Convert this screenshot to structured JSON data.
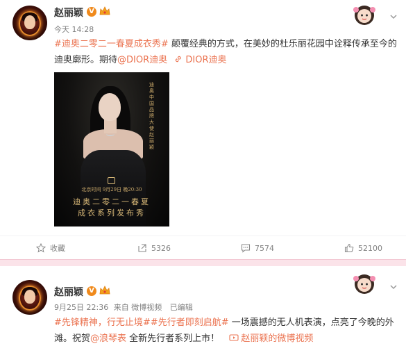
{
  "posts": [
    {
      "author": "赵丽颖",
      "verified_badge": "V",
      "time": "今天 14:28",
      "text": {
        "hashtag": "#迪奥二零二一春夏成衣秀#",
        "body1": " 颠覆经典的方式，在美妙的杜乐丽花园中诠释传承至今的迪奥廓形。期待",
        "mention": "@DIOR迪奥",
        "link": " DIOR迪奥"
      },
      "poster": {
        "vertical_text": "迪奥中国品牌大使 赵丽颖",
        "date_line": "北京时间 9月29日 晚20:30",
        "title_line1": "迪奥二零二一春夏",
        "title_line2": "成衣系列发布秀"
      },
      "actions": {
        "favorite": "收藏",
        "repost": "5326",
        "comment": "7574",
        "like": "52100"
      }
    },
    {
      "author": "赵丽颖",
      "verified_badge": "V",
      "time": "9月25日 22:36",
      "source": "来自 微博视频",
      "edited": "已编辑",
      "text": {
        "hashtag1": "#先锋精神，行无止境#",
        "hashtag2": "#先行者即刻启航#",
        "body1": " 一场震撼的无人机表演，点亮了今晚的外滩。祝贺",
        "mention": "@浪琴表",
        "body2": " 全新先行者系列上市！",
        "video_link": "赵丽颖的微博视频"
      }
    }
  ],
  "colors": {
    "link": "#eb7350",
    "separator": "#fbe3e9",
    "badge": "#f08a1c"
  },
  "icons": [
    "star-icon",
    "repost-icon",
    "comment-icon",
    "like-icon",
    "link-icon",
    "video-icon",
    "chevron-down-icon",
    "crown-icon"
  ]
}
